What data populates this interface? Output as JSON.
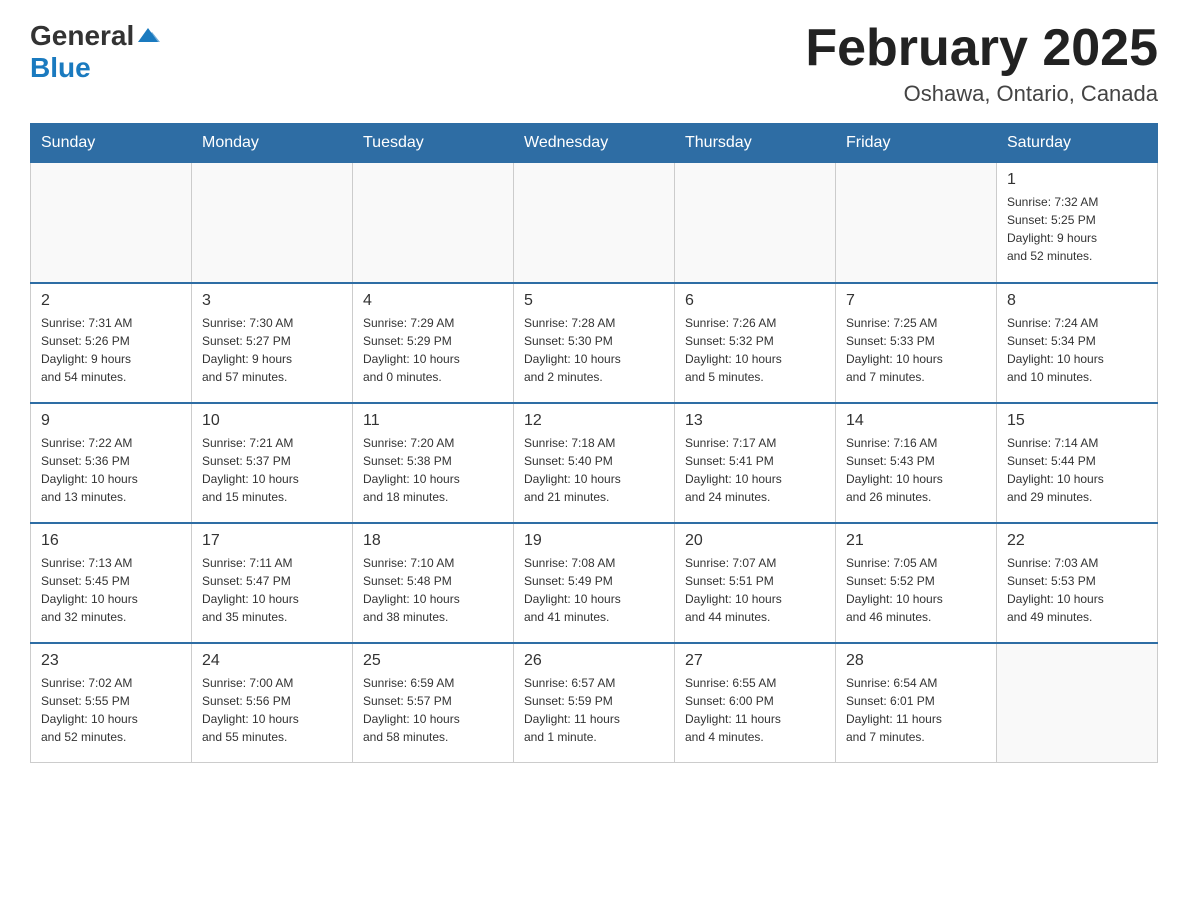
{
  "header": {
    "logo_general": "General",
    "logo_blue": "Blue",
    "title": "February 2025",
    "subtitle": "Oshawa, Ontario, Canada"
  },
  "weekdays": [
    "Sunday",
    "Monday",
    "Tuesday",
    "Wednesday",
    "Thursday",
    "Friday",
    "Saturday"
  ],
  "weeks": [
    [
      {
        "day": "",
        "info": ""
      },
      {
        "day": "",
        "info": ""
      },
      {
        "day": "",
        "info": ""
      },
      {
        "day": "",
        "info": ""
      },
      {
        "day": "",
        "info": ""
      },
      {
        "day": "",
        "info": ""
      },
      {
        "day": "1",
        "info": "Sunrise: 7:32 AM\nSunset: 5:25 PM\nDaylight: 9 hours\nand 52 minutes."
      }
    ],
    [
      {
        "day": "2",
        "info": "Sunrise: 7:31 AM\nSunset: 5:26 PM\nDaylight: 9 hours\nand 54 minutes."
      },
      {
        "day": "3",
        "info": "Sunrise: 7:30 AM\nSunset: 5:27 PM\nDaylight: 9 hours\nand 57 minutes."
      },
      {
        "day": "4",
        "info": "Sunrise: 7:29 AM\nSunset: 5:29 PM\nDaylight: 10 hours\nand 0 minutes."
      },
      {
        "day": "5",
        "info": "Sunrise: 7:28 AM\nSunset: 5:30 PM\nDaylight: 10 hours\nand 2 minutes."
      },
      {
        "day": "6",
        "info": "Sunrise: 7:26 AM\nSunset: 5:32 PM\nDaylight: 10 hours\nand 5 minutes."
      },
      {
        "day": "7",
        "info": "Sunrise: 7:25 AM\nSunset: 5:33 PM\nDaylight: 10 hours\nand 7 minutes."
      },
      {
        "day": "8",
        "info": "Sunrise: 7:24 AM\nSunset: 5:34 PM\nDaylight: 10 hours\nand 10 minutes."
      }
    ],
    [
      {
        "day": "9",
        "info": "Sunrise: 7:22 AM\nSunset: 5:36 PM\nDaylight: 10 hours\nand 13 minutes."
      },
      {
        "day": "10",
        "info": "Sunrise: 7:21 AM\nSunset: 5:37 PM\nDaylight: 10 hours\nand 15 minutes."
      },
      {
        "day": "11",
        "info": "Sunrise: 7:20 AM\nSunset: 5:38 PM\nDaylight: 10 hours\nand 18 minutes."
      },
      {
        "day": "12",
        "info": "Sunrise: 7:18 AM\nSunset: 5:40 PM\nDaylight: 10 hours\nand 21 minutes."
      },
      {
        "day": "13",
        "info": "Sunrise: 7:17 AM\nSunset: 5:41 PM\nDaylight: 10 hours\nand 24 minutes."
      },
      {
        "day": "14",
        "info": "Sunrise: 7:16 AM\nSunset: 5:43 PM\nDaylight: 10 hours\nand 26 minutes."
      },
      {
        "day": "15",
        "info": "Sunrise: 7:14 AM\nSunset: 5:44 PM\nDaylight: 10 hours\nand 29 minutes."
      }
    ],
    [
      {
        "day": "16",
        "info": "Sunrise: 7:13 AM\nSunset: 5:45 PM\nDaylight: 10 hours\nand 32 minutes."
      },
      {
        "day": "17",
        "info": "Sunrise: 7:11 AM\nSunset: 5:47 PM\nDaylight: 10 hours\nand 35 minutes."
      },
      {
        "day": "18",
        "info": "Sunrise: 7:10 AM\nSunset: 5:48 PM\nDaylight: 10 hours\nand 38 minutes."
      },
      {
        "day": "19",
        "info": "Sunrise: 7:08 AM\nSunset: 5:49 PM\nDaylight: 10 hours\nand 41 minutes."
      },
      {
        "day": "20",
        "info": "Sunrise: 7:07 AM\nSunset: 5:51 PM\nDaylight: 10 hours\nand 44 minutes."
      },
      {
        "day": "21",
        "info": "Sunrise: 7:05 AM\nSunset: 5:52 PM\nDaylight: 10 hours\nand 46 minutes."
      },
      {
        "day": "22",
        "info": "Sunrise: 7:03 AM\nSunset: 5:53 PM\nDaylight: 10 hours\nand 49 minutes."
      }
    ],
    [
      {
        "day": "23",
        "info": "Sunrise: 7:02 AM\nSunset: 5:55 PM\nDaylight: 10 hours\nand 52 minutes."
      },
      {
        "day": "24",
        "info": "Sunrise: 7:00 AM\nSunset: 5:56 PM\nDaylight: 10 hours\nand 55 minutes."
      },
      {
        "day": "25",
        "info": "Sunrise: 6:59 AM\nSunset: 5:57 PM\nDaylight: 10 hours\nand 58 minutes."
      },
      {
        "day": "26",
        "info": "Sunrise: 6:57 AM\nSunset: 5:59 PM\nDaylight: 11 hours\nand 1 minute."
      },
      {
        "day": "27",
        "info": "Sunrise: 6:55 AM\nSunset: 6:00 PM\nDaylight: 11 hours\nand 4 minutes."
      },
      {
        "day": "28",
        "info": "Sunrise: 6:54 AM\nSunset: 6:01 PM\nDaylight: 11 hours\nand 7 minutes."
      },
      {
        "day": "",
        "info": ""
      }
    ]
  ]
}
